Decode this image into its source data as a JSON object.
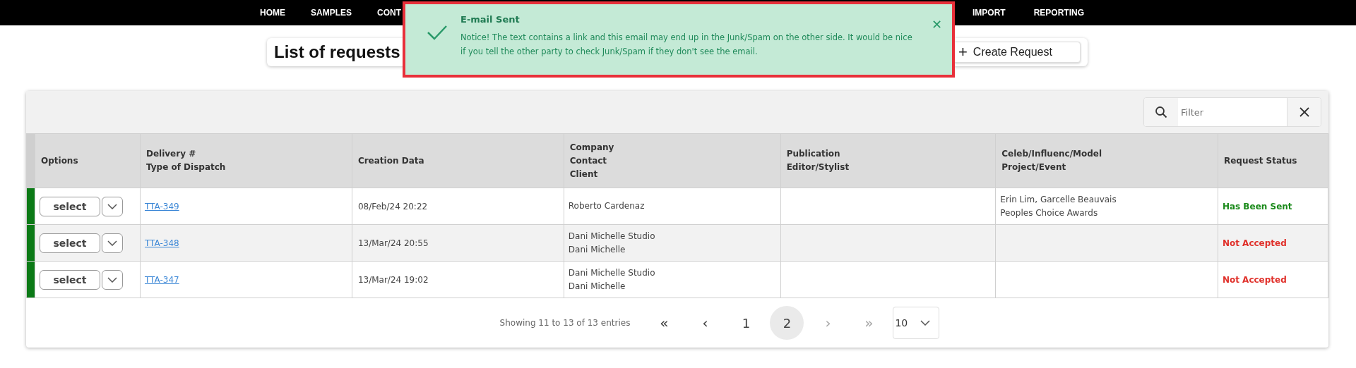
{
  "nav": {
    "left_items": [
      {
        "label": "HOME"
      },
      {
        "label": "SAMPLES"
      },
      {
        "label": "CONT"
      }
    ],
    "right_items": [
      {
        "label": "IMPORT"
      },
      {
        "label": "REPORTING"
      }
    ]
  },
  "header": {
    "title": "List of requests",
    "create_button": {
      "icon": "+",
      "label": "Create Request"
    }
  },
  "toast": {
    "title": "E-mail Sent",
    "message": "Notice! The text contains a link and this email may end up in the Junk/Spam on the other side. It would be nice if you tell the other party to check Junk/Spam if they don't see the email.",
    "close": "✕"
  },
  "table": {
    "filter": {
      "placeholder": "Filter"
    },
    "columns": [
      {
        "lines": [
          "Options"
        ]
      },
      {
        "lines": [
          "Delivery #",
          "Type of Dispatch"
        ]
      },
      {
        "lines": [
          "Creation Data"
        ]
      },
      {
        "lines": [
          "Company",
          "Contact",
          "Client"
        ]
      },
      {
        "lines": [
          "Publication",
          "Editor/Stylist"
        ]
      },
      {
        "lines": [
          "Celeb/Influenc/Model",
          "Project/Event"
        ]
      },
      {
        "lines": [
          "Request Status"
        ]
      }
    ],
    "rows": [
      {
        "color": "#0b7a16",
        "select": "select",
        "delivery": "TTA-349",
        "created": "08/Feb/24 20:22",
        "company": [
          "Roberto Cardenaz"
        ],
        "publication": [],
        "celeb": [
          "Erin Lim, Garcelle Beauvais",
          "Peoples Choice Awards"
        ],
        "status": {
          "text": "Has Been Sent",
          "color": "#1a8a1a"
        }
      },
      {
        "color": "#0b7a16",
        "select": "select",
        "delivery": "TTA-348",
        "created": "13/Mar/24 20:55",
        "company": [
          "Dani Michelle Studio",
          "Dani Michelle"
        ],
        "publication": [],
        "celeb": [],
        "status": {
          "text": "Not Accepted",
          "color": "#e0302a"
        }
      },
      {
        "color": "#0b7a16",
        "select": "select",
        "delivery": "TTA-347",
        "created": "13/Mar/24 19:02",
        "company": [
          "Dani Michelle Studio",
          "Dani Michelle"
        ],
        "publication": [],
        "celeb": [],
        "status": {
          "text": "Not Accepted",
          "color": "#e0302a"
        }
      }
    ],
    "pagination": {
      "summary": "Showing 11 to 13 of 13 entries",
      "first": "«",
      "prev": "‹",
      "pages": [
        {
          "label": "1",
          "selected": false
        },
        {
          "label": "2",
          "selected": true
        }
      ],
      "next": "›",
      "last": "»",
      "page_size": "10"
    }
  }
}
